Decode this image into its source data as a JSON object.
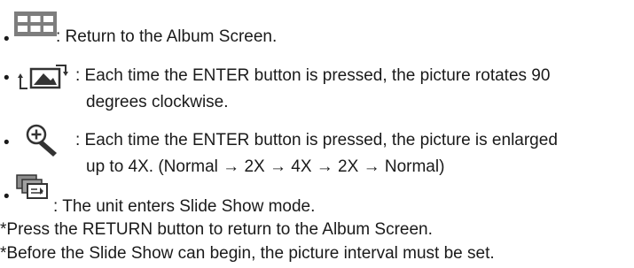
{
  "items": [
    {
      "icon": "album-grid-icon",
      "lines": [
        ": Return to the Album Screen."
      ]
    },
    {
      "icon": "rotate-picture-icon",
      "lines": [
        ": Each time the ENTER button is pressed, the picture rotates 90",
        "degrees clockwise."
      ]
    },
    {
      "icon": "zoom-in-icon",
      "lines": [
        ": Each time the ENTER button is pressed, the picture is enlarged",
        "up to 4X. (Normal → 2X → 4X → 2X → Normal)"
      ]
    },
    {
      "icon": "slide-show-icon",
      "lines": [
        ": The unit enters Slide Show mode."
      ]
    }
  ],
  "bullet": "•",
  "notes": [
    "*Press the RETURN button to return to the Album Screen.",
    "*Before the Slide Show can begin, the picture interval must be set."
  ]
}
